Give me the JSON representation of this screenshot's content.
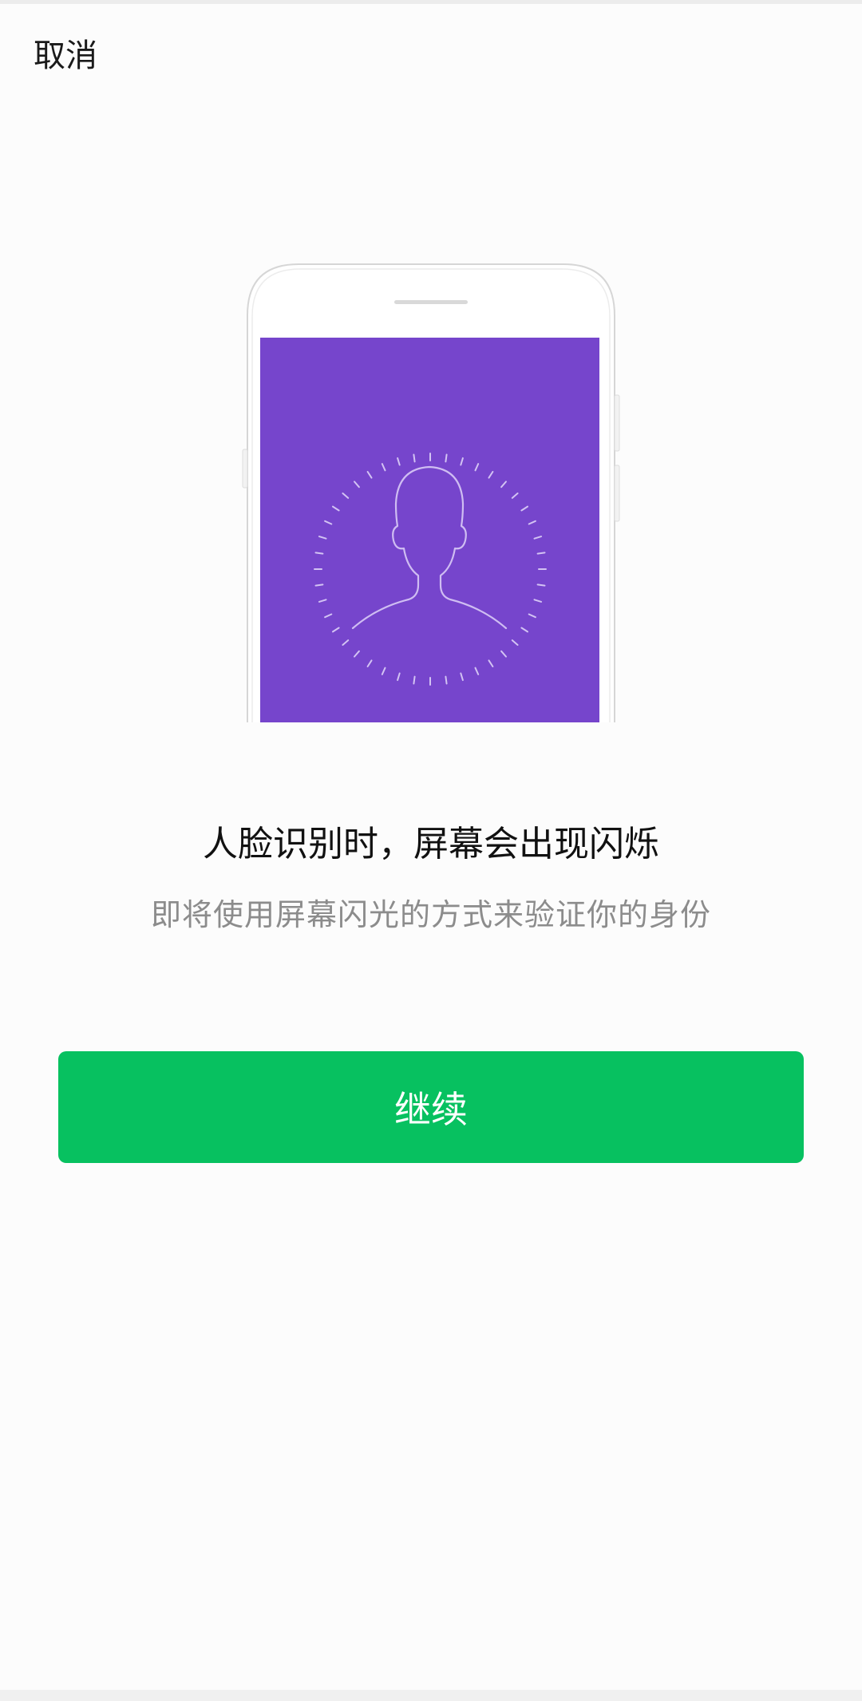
{
  "header": {
    "cancel_label": "取消"
  },
  "illustration": {
    "icon": "face-recognition-phone-icon",
    "screen_color": "#7645cc"
  },
  "main": {
    "headline": "人脸识别时，屏幕会出现闪烁",
    "subline": "即将使用屏幕闪光的方式来验证你的身份"
  },
  "actions": {
    "continue_label": "继续",
    "continue_color": "#07c160"
  }
}
